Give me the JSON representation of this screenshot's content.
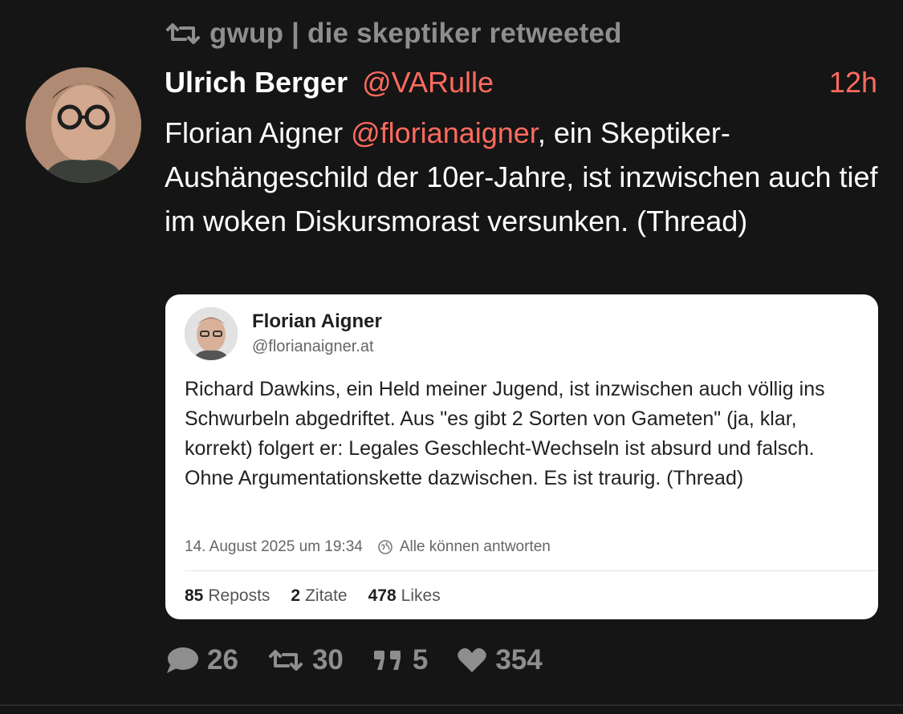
{
  "retweet": {
    "icon": "retweet-icon",
    "text": "gwup | die skeptiker retweeted"
  },
  "post": {
    "author_name": "Ulrich Berger",
    "author_handle": "@VARulle",
    "time": "12h",
    "text_before_mention": "Florian Aigner ",
    "mention": "@florianaigner",
    "text_after_mention": ", ein Skeptiker-Aushängeschild der 10er-Jahre, ist inzwischen auch tief im woken Diskursmorast versunken. (Thread)"
  },
  "quoted": {
    "name": "Florian Aigner",
    "handle": "@florianaigner.at",
    "text": "Richard Dawkins, ein Held meiner Jugend, ist inzwischen auch völlig ins Schwurbeln abgedriftet. Aus \"es gibt 2 Sorten von Gameten\" (ja, klar, korrekt) folgert er: Legales Geschlecht-Wechseln ist absurd und falsch. Ohne Argumentationskette dazwischen. Es ist traurig. (Thread)",
    "date": "14. August 2025 um 19:34",
    "reply_setting": "Alle können antworten",
    "stats": [
      {
        "num": "85",
        "label": "Reposts"
      },
      {
        "num": "2",
        "label": "Zitate"
      },
      {
        "num": "478",
        "label": "Likes"
      }
    ]
  },
  "actions": {
    "replies": "26",
    "retweets": "30",
    "quotes": "5",
    "likes": "354"
  },
  "colors": {
    "background": "#151515",
    "accent": "#ff6b5e",
    "muted": "#8e8e8e",
    "text": "#ffffff"
  }
}
